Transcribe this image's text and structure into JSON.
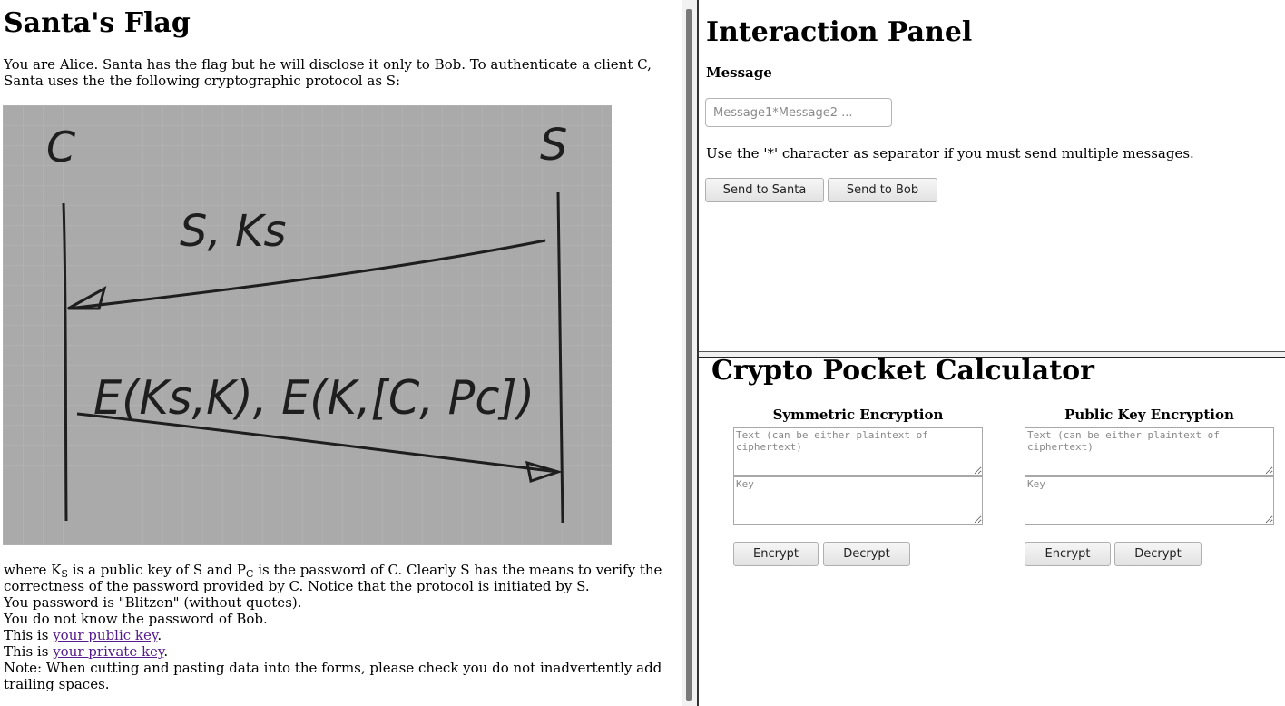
{
  "left": {
    "title": "Santa's Flag",
    "intro": "You are Alice. Santa has the flag but he will disclose it only to Bob. To authenticate a client C, Santa uses the the following cryptographic protocol as S:",
    "diagram": {
      "client_label": "C",
      "server_label": "S",
      "message1": "S, Ks",
      "message2": "E(Ks,K), E(K,[C, Pc])"
    },
    "where_part1": "where K",
    "where_sub1": "S",
    "where_part2": " is a public key of S and P",
    "where_sub2": "C",
    "where_part3": " is the password of C. Clearly S has the means to verify the correctness of the password provided by C. Notice that the protocol is initiated by S.",
    "password_line": "You password is \"Blitzen\" (without quotes).",
    "bob_line": "You do not know the password of Bob.",
    "this_is": "This is ",
    "public_key_link": "your public key",
    "private_key_link": "your private key",
    "period": ".",
    "note": "Note: When cutting and pasting data into the forms, please check you do not inadvertently add trailing spaces."
  },
  "interaction": {
    "title": "Interaction Panel",
    "message_label": "Message",
    "message_placeholder": "Message1*Message2 ...",
    "message_value": "",
    "hint": "Use the '*' character as separator if you must send multiple messages.",
    "send_santa": "Send to Santa",
    "send_bob": "Send to Bob"
  },
  "calculator": {
    "title": "Crypto Pocket Calculator",
    "symmetric": {
      "title": "Symmetric Encryption",
      "text_placeholder": "Text (can be either plaintext of ciphertext)",
      "key_placeholder": "Key",
      "encrypt": "Encrypt",
      "decrypt": "Decrypt"
    },
    "public": {
      "title": "Public Key Encryption",
      "text_placeholder": "Text (can be either plaintext of ciphertext)",
      "key_placeholder": "Key",
      "encrypt": "Encrypt",
      "decrypt": "Decrypt"
    }
  },
  "colors": {
    "link": "#551a8b",
    "diagram_bg": "#a9a9a9",
    "ink": "#1e1e1e"
  }
}
